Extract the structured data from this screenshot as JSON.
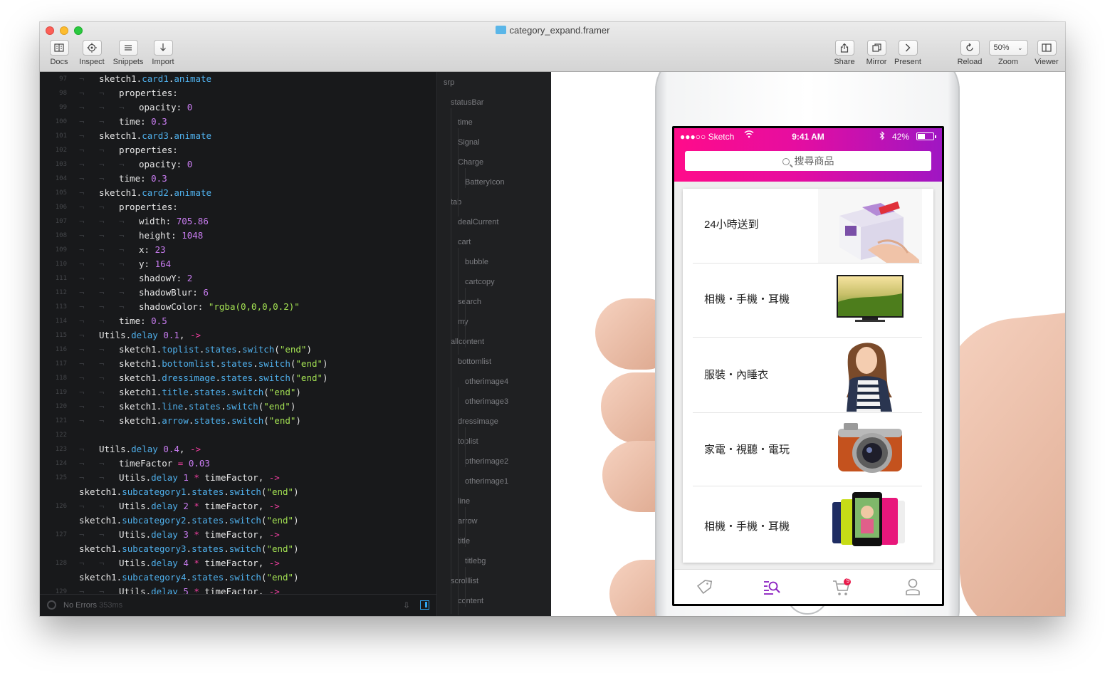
{
  "window": {
    "title": "category_expand.framer",
    "toolbar_left": [
      {
        "label": "Docs",
        "icon": "book-icon"
      },
      {
        "label": "Inspect",
        "icon": "crosshair-icon"
      },
      {
        "label": "Snippets",
        "icon": "list-icon"
      },
      {
        "label": "Import",
        "icon": "download-arrow-icon"
      }
    ],
    "toolbar_right": [
      {
        "label": "Share",
        "icon": "share-icon"
      },
      {
        "label": "Mirror",
        "icon": "mirror-icon"
      },
      {
        "label": "Present",
        "icon": "chevron-right-icon"
      },
      {
        "label": "Reload",
        "icon": "reload-icon"
      },
      {
        "label": "Zoom",
        "value": "50%"
      },
      {
        "label": "Viewer",
        "icon": "viewer-icon"
      }
    ]
  },
  "editor": {
    "lines": [
      {
        "n": "97",
        "code": "sketch1.card1.animate"
      },
      {
        "n": "98",
        "code": "properties:"
      },
      {
        "n": "99",
        "code": "opacity: 0"
      },
      {
        "n": "100",
        "code": "time: 0.3"
      },
      {
        "n": "101",
        "code": "sketch1.card3.animate"
      },
      {
        "n": "102",
        "code": "properties:"
      },
      {
        "n": "103",
        "code": "opacity: 0"
      },
      {
        "n": "104",
        "code": "time: 0.3"
      },
      {
        "n": "105",
        "code": "sketch1.card2.animate"
      },
      {
        "n": "106",
        "code": "properties:"
      },
      {
        "n": "107",
        "code": "width: 705.86"
      },
      {
        "n": "108",
        "code": "height: 1048"
      },
      {
        "n": "109",
        "code": "x: 23"
      },
      {
        "n": "110",
        "code": "y: 164"
      },
      {
        "n": "111",
        "code": "shadowY: 2"
      },
      {
        "n": "112",
        "code": "shadowBlur: 6"
      },
      {
        "n": "113",
        "code": "shadowColor: \"rgba(0,0,0,0.2)\""
      },
      {
        "n": "114",
        "code": "time: 0.5"
      },
      {
        "n": "115",
        "code": "Utils.delay 0.1, ->"
      },
      {
        "n": "116",
        "code": "sketch1.toplist.states.switch(\"end\")"
      },
      {
        "n": "117",
        "code": "sketch1.bottomlist.states.switch(\"end\")"
      },
      {
        "n": "118",
        "code": "sketch1.dressimage.states.switch(\"end\")"
      },
      {
        "n": "119",
        "code": "sketch1.title.states.switch(\"end\")"
      },
      {
        "n": "120",
        "code": "sketch1.line.states.switch(\"end\")"
      },
      {
        "n": "121",
        "code": "sketch1.arrow.states.switch(\"end\")"
      },
      {
        "n": "122",
        "code": ""
      },
      {
        "n": "123",
        "code": "Utils.delay 0.4, ->"
      },
      {
        "n": "124",
        "code": "timeFactor = 0.03"
      },
      {
        "n": "125",
        "code": "Utils.delay 1 * timeFactor, ->"
      },
      {
        "n": "",
        "code": "sketch1.subcategory1.states.switch(\"end\")"
      },
      {
        "n": "126",
        "code": "Utils.delay 2 * timeFactor, ->"
      },
      {
        "n": "",
        "code": "sketch1.subcategory2.states.switch(\"end\")"
      },
      {
        "n": "127",
        "code": "Utils.delay 3 * timeFactor, ->"
      },
      {
        "n": "",
        "code": "sketch1.subcategory3.states.switch(\"end\")"
      },
      {
        "n": "128",
        "code": "Utils.delay 4 * timeFactor, ->"
      },
      {
        "n": "",
        "code": "sketch1.subcategory4.states.switch(\"end\")"
      },
      {
        "n": "129",
        "code": "Utils.delay 5 * timeFactor, ->"
      }
    ],
    "status": "No Errors",
    "status_time": "353ms"
  },
  "layers": [
    {
      "name": "srp",
      "depth": 0
    },
    {
      "name": "statusBar",
      "depth": 1
    },
    {
      "name": "time",
      "depth": 2
    },
    {
      "name": "Signal",
      "depth": 2
    },
    {
      "name": "Charge",
      "depth": 2
    },
    {
      "name": "BatteryIcon",
      "depth": 3
    },
    {
      "name": "tab",
      "depth": 1
    },
    {
      "name": "dealCurrent",
      "depth": 2
    },
    {
      "name": "cart",
      "depth": 2
    },
    {
      "name": "bubble",
      "depth": 3
    },
    {
      "name": "cartcopy",
      "depth": 3
    },
    {
      "name": "search",
      "depth": 2
    },
    {
      "name": "my",
      "depth": 2
    },
    {
      "name": "allcontent",
      "depth": 1
    },
    {
      "name": "bottomlist",
      "depth": 2
    },
    {
      "name": "otherimage4",
      "depth": 3
    },
    {
      "name": "otherimage3",
      "depth": 3
    },
    {
      "name": "dressimage",
      "depth": 2
    },
    {
      "name": "toplist",
      "depth": 2
    },
    {
      "name": "otherimage2",
      "depth": 3
    },
    {
      "name": "otherimage1",
      "depth": 3
    },
    {
      "name": "line",
      "depth": 2
    },
    {
      "name": "arrow",
      "depth": 2
    },
    {
      "name": "title",
      "depth": 2
    },
    {
      "name": "titlebg",
      "depth": 3
    },
    {
      "name": "scrolllist",
      "depth": 1
    },
    {
      "name": "content",
      "depth": 2
    }
  ],
  "phone": {
    "status": {
      "carrier": "●●●○○ Sketch",
      "time": "9:41 AM",
      "battery": "42%"
    },
    "search_placeholder": "搜尋商品",
    "categories": [
      {
        "label": "24小時送到",
        "image": "gift-box-image"
      },
      {
        "label": "相機・手機・耳機",
        "image": "tv-image"
      },
      {
        "label": "服裝・內睡衣",
        "image": "woman-image"
      },
      {
        "label": "家電・視聽・電玩",
        "image": "camera-image"
      },
      {
        "label": "相機・手機・耳機",
        "image": "tablets-image"
      }
    ],
    "tabs": [
      {
        "name": "deals",
        "icon": "tag-icon"
      },
      {
        "name": "search",
        "icon": "search-list-icon"
      },
      {
        "name": "cart",
        "icon": "cart-icon",
        "badge": "9"
      },
      {
        "name": "account",
        "icon": "person-icon"
      }
    ],
    "accent": "#9b1fc0"
  }
}
